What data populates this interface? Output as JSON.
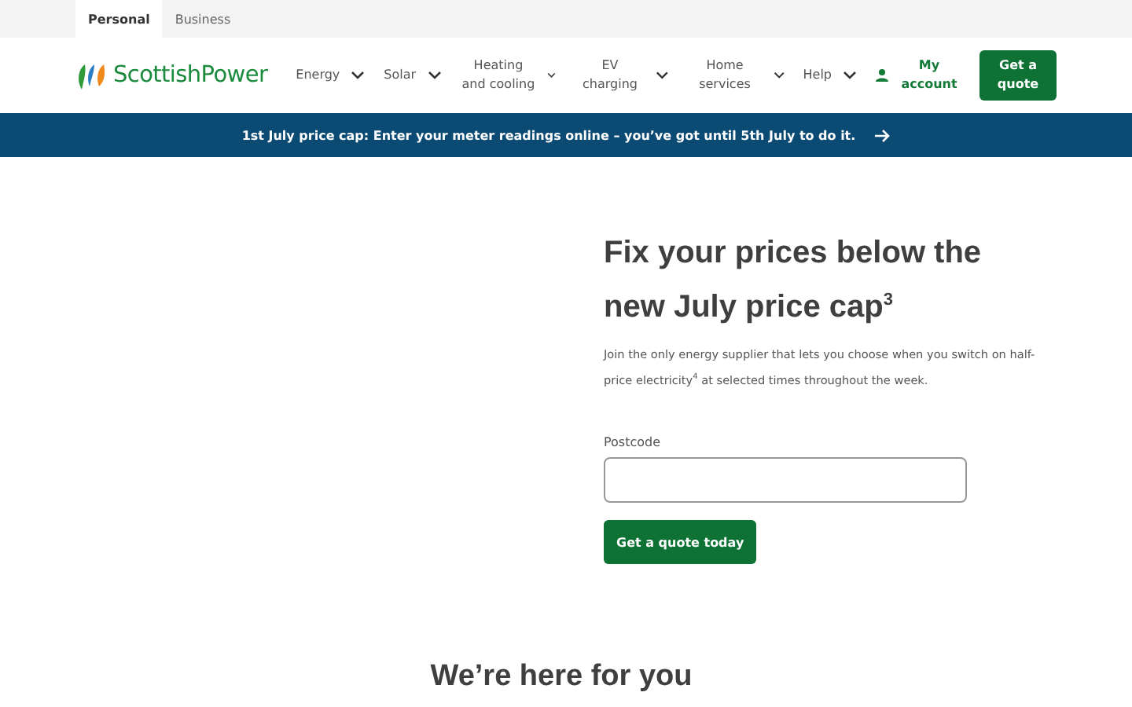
{
  "segment_tabs": [
    {
      "label": "Personal",
      "selected": true
    },
    {
      "label": "Business",
      "selected": false
    }
  ],
  "logo": {
    "text": "ScottishPower"
  },
  "nav": [
    {
      "label": "Energy"
    },
    {
      "label": "Solar"
    },
    {
      "label": "Heating and cooling"
    },
    {
      "label": "EV charging"
    },
    {
      "label": "Home services"
    },
    {
      "label": "Help"
    }
  ],
  "account_link": "My account",
  "quote_button": "Get a quote",
  "banner": {
    "text": "1st July price cap: Enter your meter readings online – you’ve got until 5th July to do it."
  },
  "hero": {
    "title": "Fix your prices below the new July price cap$^{3}$",
    "text": "Join the only energy supplier that lets you choose when you switch on half-price electricity$^{4}$ at selected times throughout the week.",
    "field_label": "Postcode",
    "button": "Get a quote today"
  },
  "section_heading": "We’re here for you"
}
